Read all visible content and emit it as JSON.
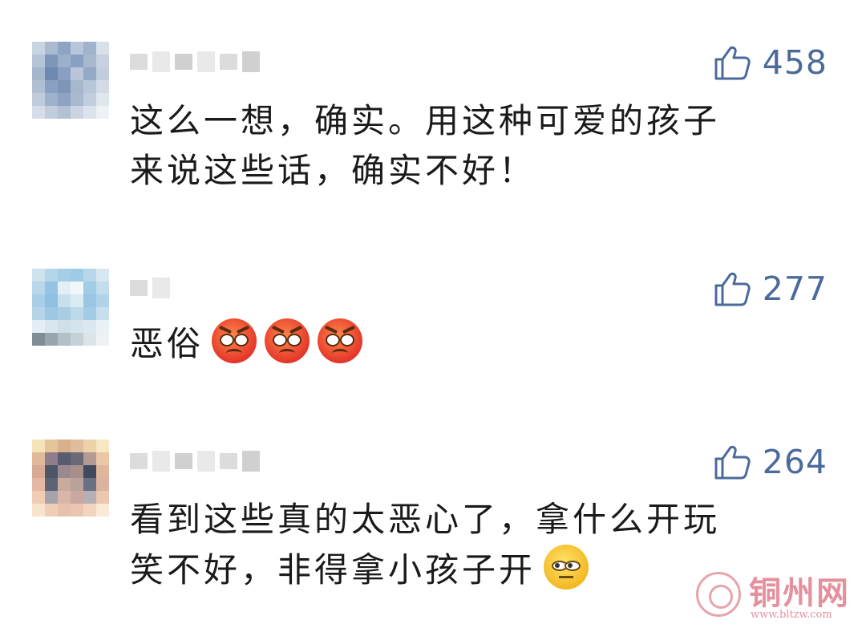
{
  "comments": [
    {
      "avatar": [
        "#c9d4e3",
        "#a9bad1",
        "#8ea4c4",
        "#b7c6da",
        "#9fb3cc",
        "#d8e0ea",
        "#b6c4d8",
        "#7f96b9",
        "#9cb0cb",
        "#8aa0c2",
        "#a7b8cf",
        "#c7d1e0",
        "#a5b6cd",
        "#6f88b0",
        "#8aa0c2",
        "#b9c6da",
        "#94a9c6",
        "#c1cddd",
        "#b0bfd4",
        "#8aa0c2",
        "#7e95b8",
        "#a6b7ce",
        "#b8c6d9",
        "#d3dbe7",
        "#c0ccdc",
        "#9fb2cc",
        "#8ea3c3",
        "#a9bad0",
        "#c2cddd",
        "#e0e6ee",
        "#d6dde8",
        "#c1ccdc",
        "#b3c1d5",
        "#cbd4e2",
        "#dde3ec",
        "#eef1f5"
      ],
      "likes": "458",
      "text_lines": [
        "这么一想，确实。用这种可爱的孩子",
        "来说这些话，确实不好！"
      ],
      "emojis": []
    },
    {
      "avatar": [
        "#cfe3ef",
        "#b4d6ea",
        "#a5cde6",
        "#9ecbe6",
        "#b7d8eb",
        "#d7e8f2",
        "#b9d7ea",
        "#94c4e2",
        "#e2eff6",
        "#f2f7fa",
        "#a1cce6",
        "#c4ddec",
        "#a8cfe7",
        "#8fc0e0",
        "#c8e0ee",
        "#dbebf4",
        "#98c6e3",
        "#b1d3e9",
        "#b5d4e8",
        "#9cc8e4",
        "#a8cde5",
        "#bed9ea",
        "#a3cbe5",
        "#c7dfed",
        "#e4eef4",
        "#d8e6ef",
        "#cfe0ea",
        "#d6e4ed",
        "#dbe8f0",
        "#eaf2f7",
        "#7f8d96",
        "#9aa6ad",
        "#b3c0c7",
        "#c6d1d7",
        "#dde4e8",
        "#eef2f4"
      ],
      "likes": "277",
      "text_lines": [
        "恶俗"
      ],
      "emojis": [
        "angry-face",
        "angry-face",
        "angry-face"
      ]
    },
    {
      "avatar": [
        "#f6e3b8",
        "#e6c49a",
        "#d9b08d",
        "#e0bd9c",
        "#efd3a8",
        "#f7e7c2",
        "#e2b89a",
        "#8e7d8c",
        "#5a5a70",
        "#6b6878",
        "#b39a94",
        "#ecc7a5",
        "#d8a993",
        "#4d5668",
        "#9a8a90",
        "#a88f8c",
        "#3f4a5e",
        "#e0b79a",
        "#e6b7a4",
        "#5c6375",
        "#c9aa9d",
        "#b9a19c",
        "#6a7084",
        "#dbb39e",
        "#f2cdb5",
        "#a7a3ad",
        "#d8b6a9",
        "#cba89f",
        "#b5afb6",
        "#edc8b0",
        "#f8e4cc",
        "#f1cfb6",
        "#e7c1ab",
        "#eac6b0",
        "#f3d5bd",
        "#fae9d6"
      ],
      "likes": "264",
      "text_lines": [
        "看到这些真的太恶心了，拿什么开玩",
        "笑不好，非得拿小孩子开"
      ],
      "emojis": [
        "eye-roll-face"
      ]
    }
  ],
  "watermark": {
    "title": "铜州网",
    "url": "www.bltzw.com"
  }
}
